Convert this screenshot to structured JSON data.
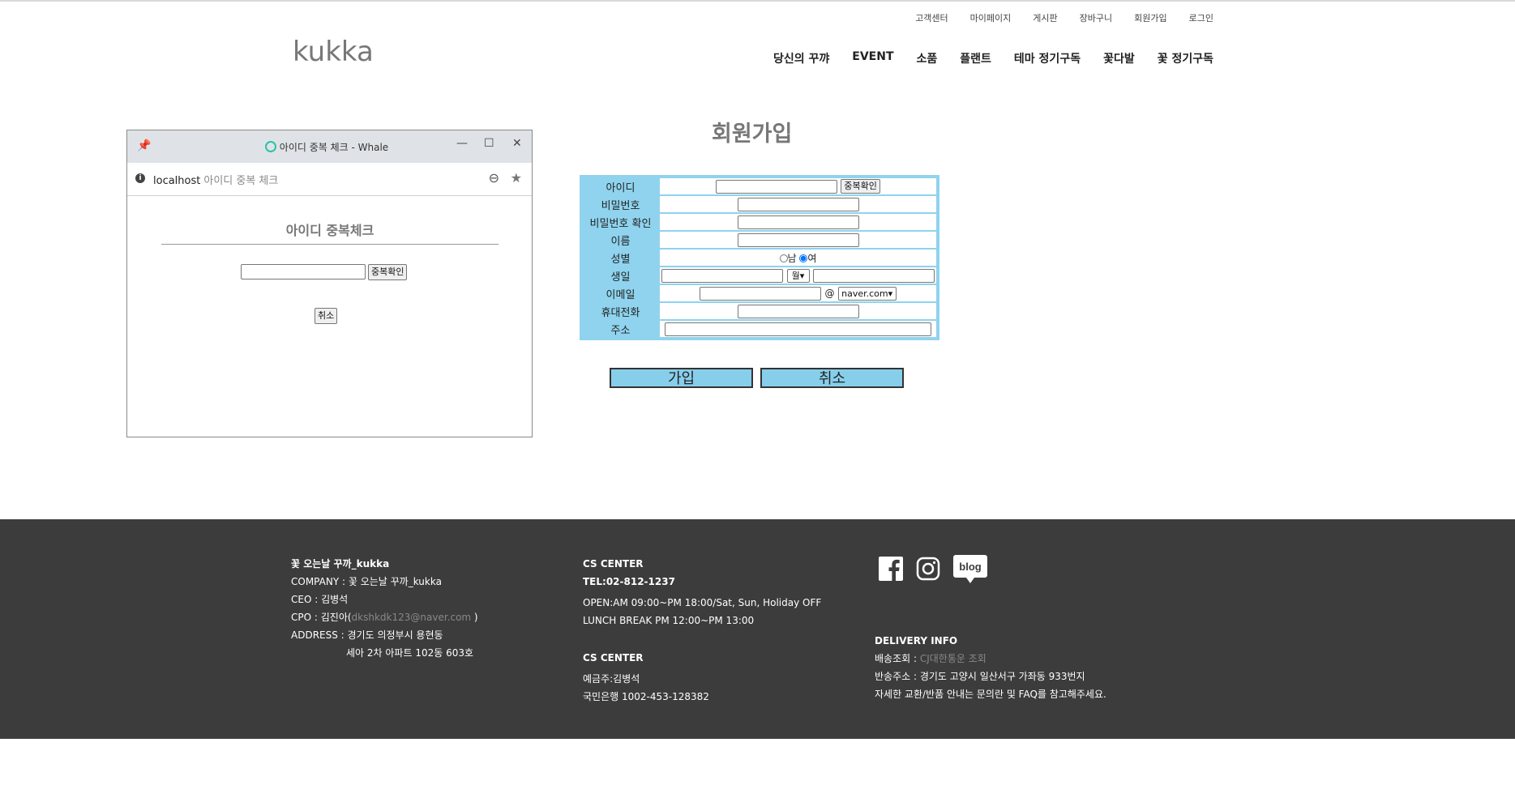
{
  "util_nav": [
    "고객센터",
    "마이페이지",
    "게시판",
    "장바구니",
    "회원가입",
    "로그인"
  ],
  "logo": "kukka",
  "main_nav": [
    "당신의 꾸꺄",
    "EVENT",
    "소품",
    "플랜트",
    "테마 정기구독",
    "꽃다발",
    "꽃 정기구독"
  ],
  "page_title": "회원가입",
  "form": {
    "id_label": "아이디",
    "dup_check": "중복확인",
    "pw_label": "비밀번호",
    "pw_confirm_label": "비밀번호 확인",
    "name_label": "이름",
    "gender_label": "성별",
    "gender_male": "남",
    "gender_female": "여",
    "gender_selected": "여",
    "birth_label": "생일",
    "birth_month": "월",
    "email_label": "이메일",
    "email_at": "@",
    "email_domain": "naver.com",
    "phone_label": "휴대전화",
    "address_label": "주소",
    "submit": "가입",
    "cancel": "취소"
  },
  "popup": {
    "window_title": "아이디 중복 체크 - Whale",
    "host": "localhost",
    "tab_hint": "아이디 중복 체크",
    "heading": "아이디 중복체크",
    "check_button": "중복확인",
    "cancel_button": "취소"
  },
  "footer": {
    "company": {
      "title": "꽃 오는날 꾸까_kukka",
      "company_line": "COMPANY : 꽃 오는날 꾸까_kukka",
      "ceo_line": "CEO : 김병석",
      "cpo_prefix": "CPO : 김진아(",
      "cpo_email": "dkshkdk123@naver.com",
      "cpo_suffix": " )",
      "address_line1": "ADDRESS : 경기도 의정부시 용현동",
      "address_line2": "세아 2차 아파트 102동 603호"
    },
    "cs": {
      "title": "CS CENTER",
      "tel": "TEL:02-812-1237",
      "open": "OPEN:AM 09:00~PM 18:00/Sat, Sun, Holiday OFF",
      "lunch": "LUNCH BREAK PM 12:00~PM 13:00"
    },
    "bank": {
      "title": "CS CENTER",
      "holder": "예금주:김병석",
      "account": "국민은행 1002-453-128382"
    },
    "social": [
      "facebook-icon",
      "instagram-icon",
      "blog-icon"
    ],
    "social_blog_text": "blog",
    "delivery": {
      "title": "DELIVERY INFO",
      "track_prefix": "배송조회 : ",
      "track_link": "CJ대한통운 조회",
      "return_addr": "반송주소 : 경기도 고양시 일산서구 가좌동 933번지",
      "notice": "자세한 교환/반품 안내는 문의란 및 FAQ를 참고해주세요."
    }
  }
}
